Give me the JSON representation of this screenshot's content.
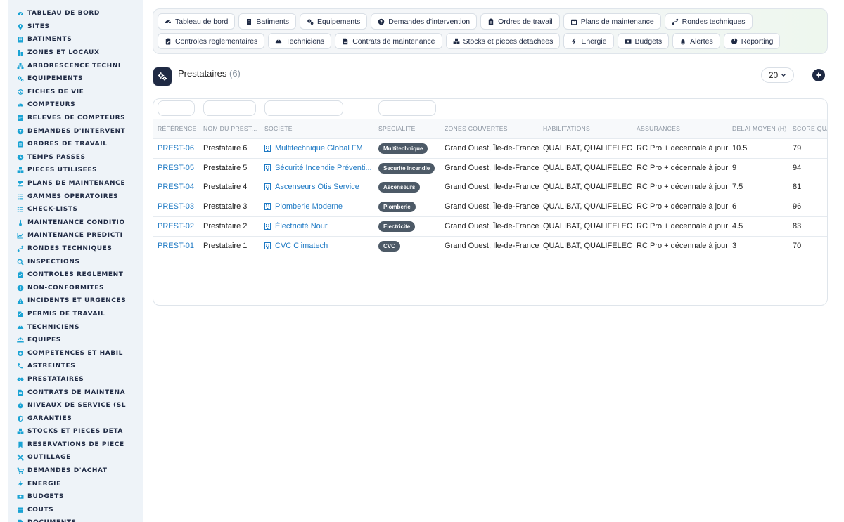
{
  "sidebar": {
    "items": [
      {
        "label": "TABLEAU DE BORD",
        "icon": "dashboard-icon"
      },
      {
        "label": "SITES",
        "icon": "map-pin-icon"
      },
      {
        "label": "BATIMENTS",
        "icon": "building-icon"
      },
      {
        "label": "ZONES ET LOCAUX",
        "icon": "zones-icon"
      },
      {
        "label": "ARBORESCENCE TECHNI",
        "icon": "tree-icon"
      },
      {
        "label": "EQUIPEMENTS",
        "icon": "gears-icon"
      },
      {
        "label": "FICHES DE VIE",
        "icon": "history-icon"
      },
      {
        "label": "COMPTEURS",
        "icon": "gauge-icon"
      },
      {
        "label": "RELEVES DE COMPTEURS",
        "icon": "reading-icon"
      },
      {
        "label": "DEMANDES D'INTERVENT",
        "icon": "question-icon"
      },
      {
        "label": "ORDRES DE TRAVAIL",
        "icon": "clipboard-icon"
      },
      {
        "label": "TEMPS PASSES",
        "icon": "clock-icon"
      },
      {
        "label": "PIECES UTILISEES",
        "icon": "boxes-icon"
      },
      {
        "label": "PLANS DE MAINTENANCE",
        "icon": "calendar-icon"
      },
      {
        "label": "GAMMES OPERATOIRES",
        "icon": "list-icon"
      },
      {
        "label": "CHECK-LISTS",
        "icon": "checklist-icon"
      },
      {
        "label": "MAINTENANCE CONDITIO",
        "icon": "thermometer-icon"
      },
      {
        "label": "MAINTENANCE PREDICTI",
        "icon": "chart-line-icon"
      },
      {
        "label": "RONDES TECHNIQUES",
        "icon": "route-icon"
      },
      {
        "label": "INSPECTIONS",
        "icon": "search-icon"
      },
      {
        "label": "CONTROLES REGLEMENT",
        "icon": "clipboard-check-icon"
      },
      {
        "label": "NON-CONFORMITES",
        "icon": "alert-circle-icon"
      },
      {
        "label": "INCIDENTS ET URGENCES",
        "icon": "warning-icon"
      },
      {
        "label": "PERMIS DE TRAVAIL",
        "icon": "permit-icon"
      },
      {
        "label": "TECHNICIENS",
        "icon": "worker-icon"
      },
      {
        "label": "EQUIPES",
        "icon": "team-icon"
      },
      {
        "label": "COMPETENCES ET HABIL",
        "icon": "certificate-icon"
      },
      {
        "label": "ASTREINTES",
        "icon": "phone-icon"
      },
      {
        "label": "PRESTATAIRES",
        "icon": "handshake-icon"
      },
      {
        "label": "CONTRATS DE MAINTENA",
        "icon": "contract-icon"
      },
      {
        "label": "NIVEAUX DE SERVICE (SL",
        "icon": "stopwatch-icon"
      },
      {
        "label": "GARANTIES",
        "icon": "shield-icon"
      },
      {
        "label": "STOCKS ET PIECES DETA",
        "icon": "stock-icon"
      },
      {
        "label": "RESERVATIONS DE PIECE",
        "icon": "bookmark-icon"
      },
      {
        "label": "OUTILLAGE",
        "icon": "tools-icon"
      },
      {
        "label": "DEMANDES D'ACHAT",
        "icon": "cart-icon"
      },
      {
        "label": "ENERGIE",
        "icon": "bolt-icon"
      },
      {
        "label": "BUDGETS",
        "icon": "money-icon"
      },
      {
        "label": "COUTS",
        "icon": "coins-icon"
      },
      {
        "label": "DOCUMENTS",
        "icon": "document-icon"
      }
    ]
  },
  "topnav": {
    "row1": [
      {
        "label": "Tableau de bord",
        "icon": "dashboard-icon"
      },
      {
        "label": "Batiments",
        "icon": "building-icon"
      },
      {
        "label": "Equipements",
        "icon": "gears-icon"
      },
      {
        "label": "Demandes d'intervention",
        "icon": "question-icon"
      },
      {
        "label": "Ordres de travail",
        "icon": "clipboard-icon"
      },
      {
        "label": "Plans de maintenance",
        "icon": "calendar-icon"
      },
      {
        "label": "Rondes techniques",
        "icon": "route-icon"
      }
    ],
    "row2": [
      {
        "label": "Controles reglementaires",
        "icon": "clipboard-check-icon"
      },
      {
        "label": "Techniciens",
        "icon": "worker-icon"
      },
      {
        "label": "Contrats de maintenance",
        "icon": "contract-icon"
      },
      {
        "label": "Stocks et pieces detachees",
        "icon": "boxes-icon"
      },
      {
        "label": "Energie",
        "icon": "bolt-icon"
      },
      {
        "label": "Budgets",
        "icon": "money-icon"
      },
      {
        "label": "Alertes",
        "icon": "bell-icon"
      },
      {
        "label": "Reporting",
        "icon": "pie-chart-icon"
      }
    ]
  },
  "header": {
    "title": "Prestataires",
    "count": "(6)",
    "page_size": "20"
  },
  "table": {
    "columns": [
      "RÉFÉRENCE",
      "NOM DU PREST...",
      "SOCIETE",
      "SPECIALITE",
      "ZONES COUVERTES",
      "HABILITATIONS",
      "ASSURANCES",
      "DELAI MOYEN (H)",
      "SCORE QUA"
    ],
    "rows": [
      {
        "ref": "PREST-06",
        "nom": "Prestataire 6",
        "societe": "Multitechnique Global FM",
        "specialite": "Multitechnique",
        "zones": "Grand Ouest, Île-de-France",
        "habilitations": "QUALIBAT, QUALIFELEC",
        "assurances": "RC Pro + décennale à jour",
        "delai": "10.5",
        "score": "79"
      },
      {
        "ref": "PREST-05",
        "nom": "Prestataire 5",
        "societe": "Sécurité Incendie Préventi...",
        "specialite": "Securite incendie",
        "zones": "Grand Ouest, Île-de-France",
        "habilitations": "QUALIBAT, QUALIFELEC",
        "assurances": "RC Pro + décennale à jour",
        "delai": "9",
        "score": "94"
      },
      {
        "ref": "PREST-04",
        "nom": "Prestataire 4",
        "societe": "Ascenseurs Otis Service",
        "specialite": "Ascenseurs",
        "zones": "Grand Ouest, Île-de-France",
        "habilitations": "QUALIBAT, QUALIFELEC",
        "assurances": "RC Pro + décennale à jour",
        "delai": "7.5",
        "score": "81"
      },
      {
        "ref": "PREST-03",
        "nom": "Prestataire 3",
        "societe": "Plomberie Moderne",
        "specialite": "Plomberie",
        "zones": "Grand Ouest, Île-de-France",
        "habilitations": "QUALIBAT, QUALIFELEC",
        "assurances": "RC Pro + décennale à jour",
        "delai": "6",
        "score": "96"
      },
      {
        "ref": "PREST-02",
        "nom": "Prestataire 2",
        "societe": "Électricité Nour",
        "specialite": "Electricite",
        "zones": "Grand Ouest, Île-de-France",
        "habilitations": "QUALIBAT, QUALIFELEC",
        "assurances": "RC Pro + décennale à jour",
        "delai": "4.5",
        "score": "83"
      },
      {
        "ref": "PREST-01",
        "nom": "Prestataire 1",
        "societe": "CVC Climatech",
        "specialite": "CVC",
        "zones": "Grand Ouest, Île-de-France",
        "habilitations": "QUALIBAT, QUALIFELEC",
        "assurances": "RC Pro + décennale à jour",
        "delai": "3",
        "score": "70"
      }
    ]
  },
  "colors": {
    "accent": "#1aa3d4",
    "link": "#1f7ac4",
    "navy": "#1f2a44",
    "badge": "#4d5a67"
  }
}
